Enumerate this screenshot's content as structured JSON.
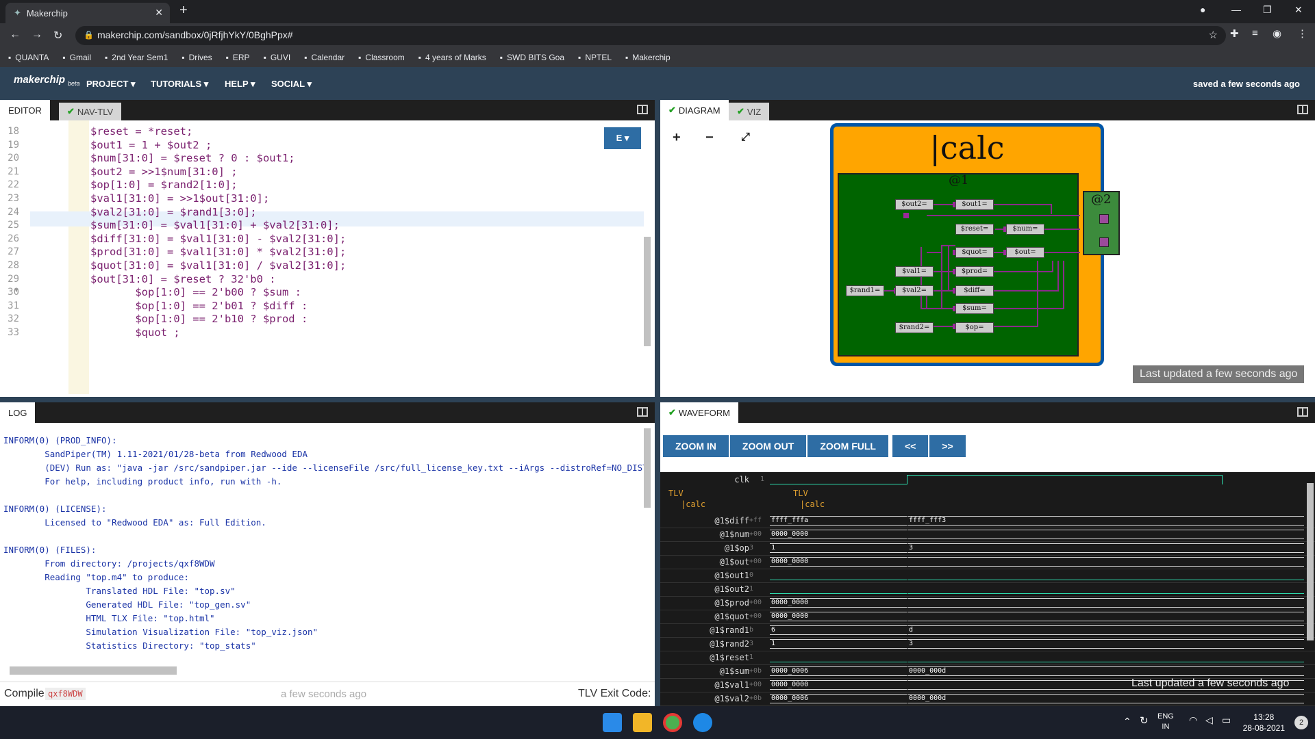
{
  "browser": {
    "tab_title": "Makerchip",
    "url": "makerchip.com/sandbox/0jRfjhYkY/0BghPpx#",
    "bookmarks": [
      "QUANTA",
      "Gmail",
      "2nd Year Sem1",
      "Drives",
      "ERP",
      "GUVI",
      "Calendar",
      "Classroom",
      "4 years of Marks",
      "SWD BITS Goa",
      "NPTEL",
      "Makerchip"
    ]
  },
  "app": {
    "logo": "makerchip",
    "logo_sub": "beta",
    "menus": [
      "PROJECT ▾",
      "TUTORIALS ▾",
      "HELP ▾",
      "SOCIAL ▾"
    ],
    "saved_status": "saved a few seconds ago"
  },
  "editor": {
    "tabs": [
      "EDITOR",
      "NAV-TLV"
    ],
    "e_button": "E ▾",
    "lines": [
      {
        "num": "18",
        "code": "$reset = *reset;"
      },
      {
        "num": "19",
        "code": "$out1 = 1 + $out2 ;"
      },
      {
        "num": "20",
        "code": "$num[31:0] = $reset ? 0 : $out1;"
      },
      {
        "num": "21",
        "code": "$out2 = >>1$num[31:0] ;"
      },
      {
        "num": "22",
        "code": "$op[1:0] = $rand2[1:0];"
      },
      {
        "num": "23",
        "code": "$val1[31:0] = >>1$out[31:0];"
      },
      {
        "num": "24",
        "code": "$val2[31:0] = $rand1[3:0];"
      },
      {
        "num": "25",
        "code": "$sum[31:0] = $val1[31:0] + $val2[31:0];"
      },
      {
        "num": "26",
        "code": "$diff[31:0] = $val1[31:0] - $val2[31:0];"
      },
      {
        "num": "27",
        "code": "$prod[31:0] = $val1[31:0] * $val2[31:0];"
      },
      {
        "num": "28",
        "code": "$quot[31:0] = $val1[31:0] / $val2[31:0];"
      },
      {
        "num": "29 ▾",
        "code": "$out[31:0] = $reset ? 32'b0 :"
      },
      {
        "num": "30",
        "code": "       $op[1:0] == 2'b00 ? $sum :"
      },
      {
        "num": "31",
        "code": "       $op[1:0] == 2'b01 ? $diff :"
      },
      {
        "num": "32",
        "code": "       $op[1:0] == 2'b10 ? $prod :"
      },
      {
        "num": "33",
        "code": "       $quot ;"
      }
    ]
  },
  "diagram": {
    "tabs": [
      "DIAGRAM",
      "VIZ"
    ],
    "title": "|calc",
    "stage1": "@1",
    "stage2": "@2",
    "signals": [
      "$out2=",
      "$out1=",
      "$reset=",
      "$num=",
      "$quot=",
      "$out=",
      "$val1=",
      "$prod=",
      "$rand1=",
      "$val2=",
      "$diff=",
      "$sum=",
      "$rand2=",
      "$op="
    ],
    "last_updated": "Last updated a few seconds ago"
  },
  "log": {
    "tab": "LOG",
    "lines": [
      "INFORM(0) (PROD_INFO):",
      "        SandPiper(TM) 1.11-2021/01/28-beta from Redwood EDA",
      "        (DEV) Run as: \"java -jar /src/sandpiper.jar --ide --licenseFile /src/full_license_key.txt --iArgs --distroRef=NO_DIST",
      "        For help, including product info, run with -h.",
      "",
      "INFORM(0) (LICENSE):",
      "        Licensed to \"Redwood EDA\" as: Full Edition.",
      "",
      "INFORM(0) (FILES):",
      "        From directory: /projects/qxf8WDW",
      "        Reading \"top.m4\" to produce:",
      "                Translated HDL File: \"top.sv\"",
      "                Generated HDL File: \"top_gen.sv\"",
      "                HTML TLX File: \"top.html\"",
      "                Simulation Visualization File: \"top_viz.json\"",
      "                Statistics Directory: \"top_stats\""
    ],
    "compile_label": "Compile",
    "compile_id": "qxf8WDW",
    "compile_time": "a few seconds ago",
    "exit_code_label": "TLV Exit Code:"
  },
  "waveform": {
    "tab": "WAVEFORM",
    "buttons": [
      "ZOOM IN",
      "ZOOM OUT",
      "ZOOM FULL",
      "<<",
      ">>"
    ],
    "clock": {
      "label": "clk",
      "val": "1"
    },
    "scope_labels": [
      "TLV",
      "|calc"
    ],
    "rows": [
      {
        "label": "@1$diff",
        "val": "+ff",
        "a": "ffff_fffa",
        "b": "ffff_fff3"
      },
      {
        "label": "@1$num",
        "val": "+00",
        "a": "0000_0000",
        "b": ""
      },
      {
        "label": "@1$op",
        "val": "3",
        "a": "1",
        "b": "3"
      },
      {
        "label": "@1$out",
        "val": "+00",
        "a": "0000_0000",
        "b": ""
      },
      {
        "label": "@1$out1",
        "val": "0",
        "a": "",
        "b": ""
      },
      {
        "label": "@1$out2",
        "val": "1",
        "a": "",
        "b": ""
      },
      {
        "label": "@1$prod",
        "val": "+00",
        "a": "0000_0000",
        "b": ""
      },
      {
        "label": "@1$quot",
        "val": "+00",
        "a": "0000_0000",
        "b": ""
      },
      {
        "label": "@1$rand1",
        "val": "b",
        "a": "6",
        "b": "d"
      },
      {
        "label": "@1$rand2",
        "val": "3",
        "a": "1",
        "b": "3"
      },
      {
        "label": "@1$reset",
        "val": "1",
        "a": "",
        "b": ""
      },
      {
        "label": "@1$sum",
        "val": "+0b",
        "a": "0000_0006",
        "b": "0000_000d"
      },
      {
        "label": "@1$val1",
        "val": "+00",
        "a": "0000_0000",
        "b": ""
      },
      {
        "label": "@1$val2",
        "val": "+0b",
        "a": "0000_0006",
        "b": "0000_000d"
      }
    ],
    "last_updated": "Last updated a few seconds ago"
  },
  "taskbar": {
    "lang": "ENG",
    "region": "IN",
    "time": "13:28",
    "date": "28-08-2021",
    "notif": "2"
  }
}
